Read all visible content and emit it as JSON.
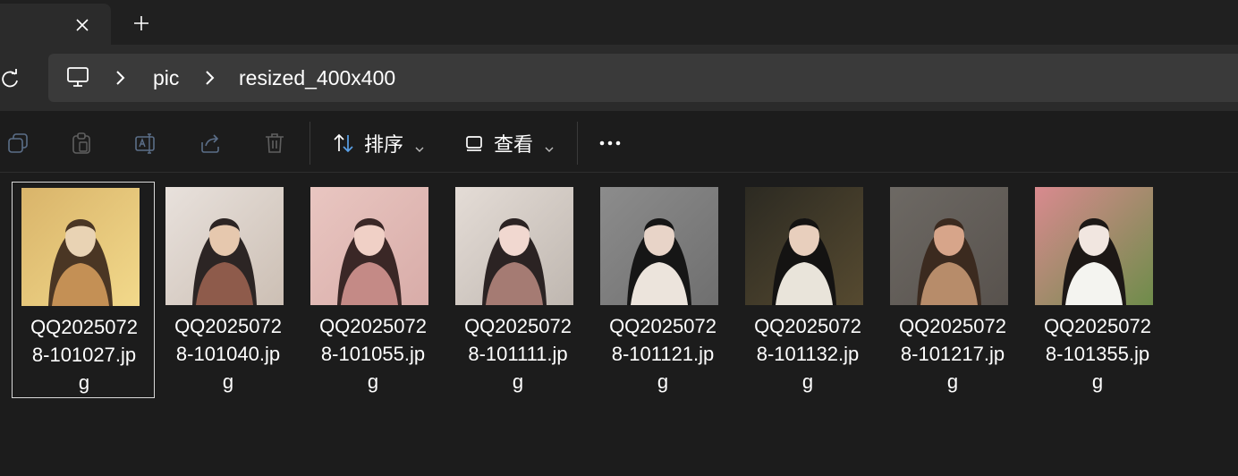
{
  "tab": {
    "close_icon": "close-icon",
    "new_tab_icon": "plus-icon"
  },
  "nav": {
    "refresh_icon": "refresh-icon"
  },
  "address": {
    "root_icon": "computer-icon",
    "crumbs": [
      "pic",
      "resized_400x400"
    ]
  },
  "toolbar": {
    "sort_label": "排序",
    "view_label": "查看",
    "more_label": "···",
    "icons": [
      "copy-icon",
      "paste-icon",
      "rename-icon",
      "share-icon",
      "delete-icon"
    ]
  },
  "files": [
    {
      "name": "QQ20250728-101027.jpg",
      "lines": [
        "QQ2025072",
        "8-101027.jp",
        "g"
      ],
      "selected": true,
      "colors": [
        "#d9b46a",
        "#f2d98b",
        "#4a3624",
        "#e9d3b4",
        "#c49055"
      ]
    },
    {
      "name": "QQ20250728-101040.jpg",
      "lines": [
        "QQ2025072",
        "8-101040.jp",
        "g"
      ],
      "selected": false,
      "colors": [
        "#e8e1dc",
        "#ccbfb4",
        "#2c2524",
        "#e6c8ae",
        "#8e5b4b"
      ]
    },
    {
      "name": "QQ20250728-101055.jpg",
      "lines": [
        "QQ2025072",
        "8-101055.jp",
        "g"
      ],
      "selected": false,
      "colors": [
        "#e9c6c1",
        "#d8aca8",
        "#3a2726",
        "#f0d0c6",
        "#c48a86"
      ]
    },
    {
      "name": "QQ20250728-101111.jpg",
      "lines": [
        "QQ2025072",
        "8-101111.jp",
        "g"
      ],
      "selected": false,
      "colors": [
        "#e4dcd6",
        "#bfb7b0",
        "#2b2323",
        "#f1d8d0",
        "#a57b73"
      ]
    },
    {
      "name": "QQ20250728-101121.jpg",
      "lines": [
        "QQ2025072",
        "8-101121.jp",
        "g"
      ],
      "selected": false,
      "colors": [
        "#8c8c8c",
        "#6f6f6f",
        "#161616",
        "#e8d4c8",
        "#ece4dc"
      ]
    },
    {
      "name": "QQ20250728-101132.jpg",
      "lines": [
        "QQ2025072",
        "8-101132.jp",
        "g"
      ],
      "selected": false,
      "colors": [
        "#2c2a22",
        "#564a30",
        "#141312",
        "#e8cfbd",
        "#e9e4da"
      ]
    },
    {
      "name": "QQ20250728-101217.jpg",
      "lines": [
        "QQ2025072",
        "8-101217.jp",
        "g"
      ],
      "selected": false,
      "colors": [
        "#6d6964",
        "#58524d",
        "#3b2a1f",
        "#d7a58a",
        "#b78c6a"
      ]
    },
    {
      "name": "QQ20250728-101355.jpg",
      "lines": [
        "QQ2025072",
        "8-101355.jp",
        "g"
      ],
      "selected": false,
      "colors": [
        "#d98a8f",
        "#6e8c4a",
        "#1d1816",
        "#f1e6e0",
        "#f4f4f0"
      ]
    }
  ]
}
